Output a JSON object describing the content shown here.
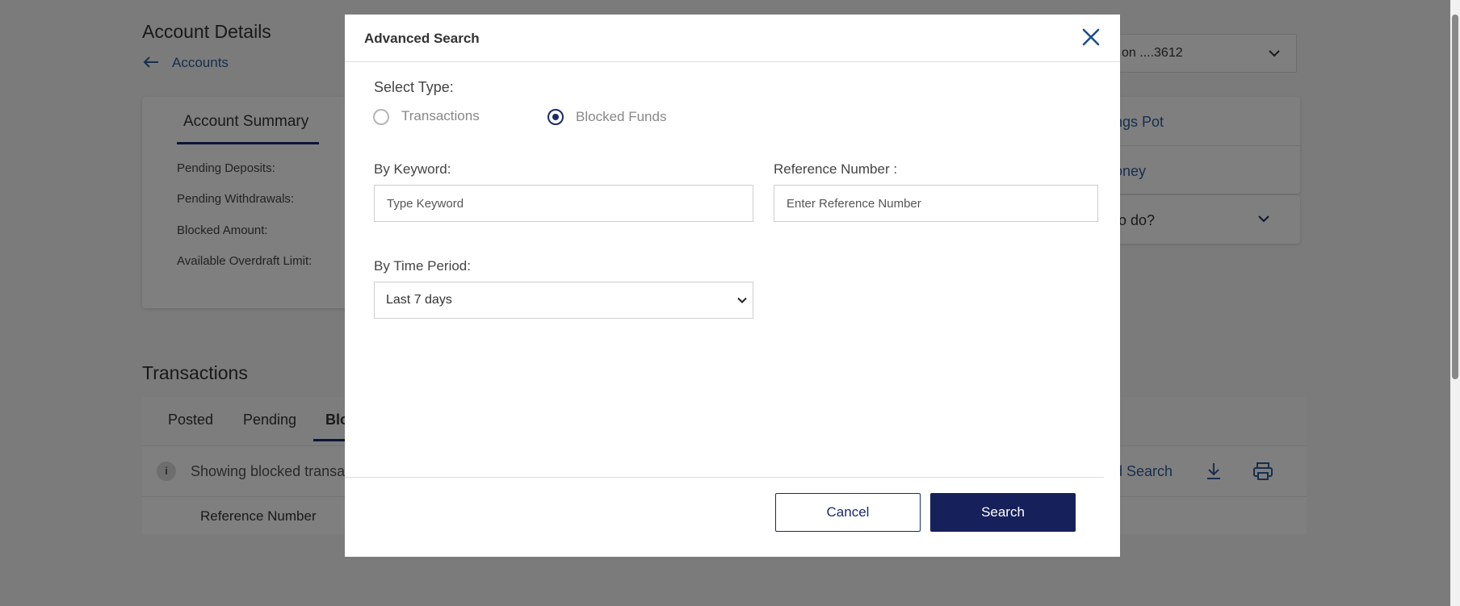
{
  "background": {
    "page_title": "Account Details",
    "back_link": "Accounts",
    "account_selector": "on ....3612",
    "summary": {
      "tab": "Account Summary",
      "rows": [
        "Pending Deposits:",
        "Pending Withdrawals:",
        "Blocked Amount:",
        "Available Overdraft Limit:"
      ]
    },
    "quick_links": [
      "ngs Pot",
      "oney"
    ],
    "todo_dropdown": "to do?",
    "transactions": {
      "heading": "Transactions",
      "tabs": [
        "Posted",
        "Pending",
        "Blo"
      ],
      "info_text": "Showing blocked transact",
      "advanced_search_link": "d Search",
      "column_header": "Reference Number"
    }
  },
  "modal": {
    "title": "Advanced Search",
    "select_type_label": "Select Type:",
    "type_options": [
      {
        "label": "Transactions",
        "selected": false
      },
      {
        "label": "Blocked Funds",
        "selected": true
      }
    ],
    "keyword": {
      "label": "By Keyword:",
      "placeholder": "Type Keyword",
      "value": ""
    },
    "reference": {
      "label": "Reference Number :",
      "placeholder": "Enter Reference Number",
      "value": ""
    },
    "time_period": {
      "label": "By Time Period:",
      "selected": "Last 7 days"
    },
    "cancel_label": "Cancel",
    "search_label": "Search"
  },
  "colors": {
    "primary": "#16215b",
    "link": "#2f5f9a",
    "overlay": "rgba(0,0,0,0.5)"
  }
}
